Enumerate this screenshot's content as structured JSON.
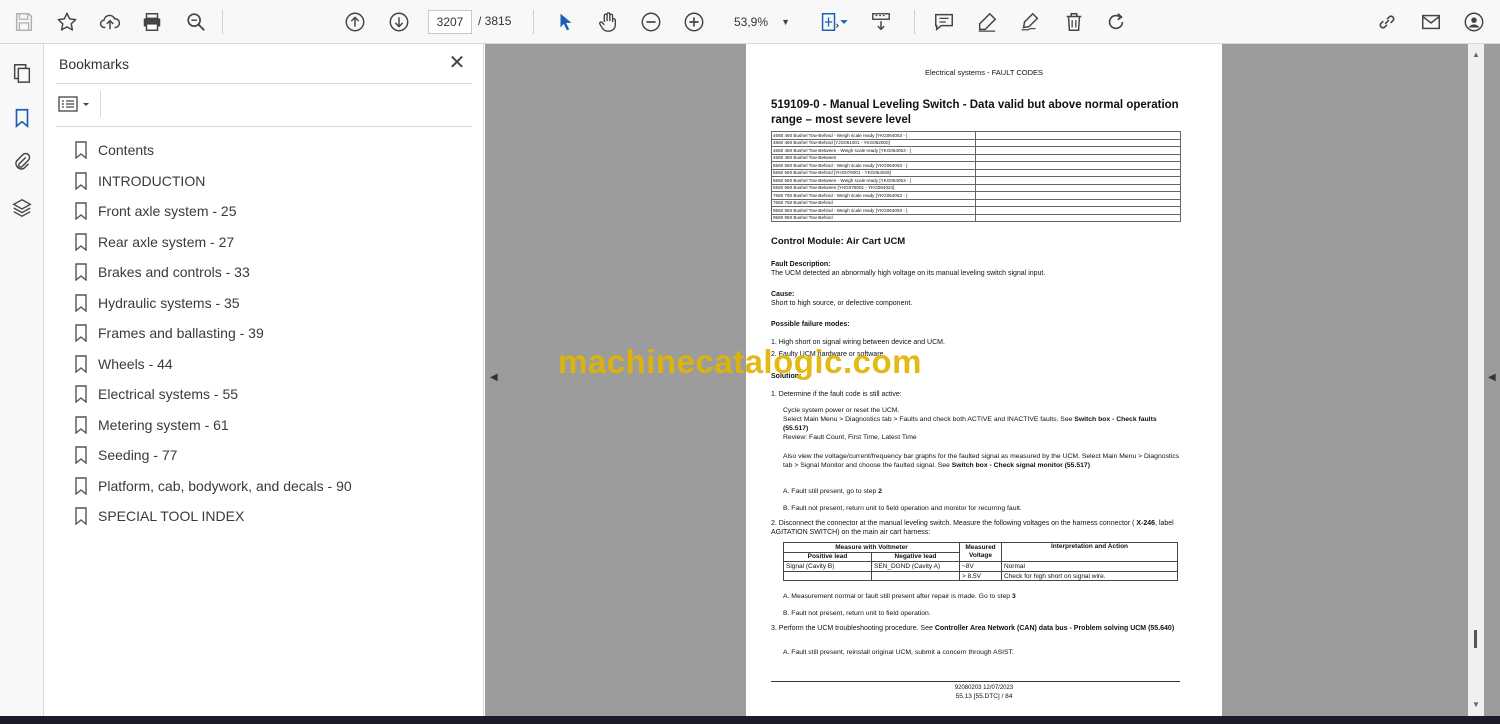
{
  "toolbar": {
    "current_page": "3207",
    "total_pages": "/ 3815",
    "zoom": "53,9%"
  },
  "bookmarks": {
    "title": "Bookmarks",
    "items": [
      {
        "label": "Contents"
      },
      {
        "label": "INTRODUCTION"
      },
      {
        "label": "Front axle system - 25"
      },
      {
        "label": "Rear axle system - 27"
      },
      {
        "label": "Brakes and controls - 33"
      },
      {
        "label": "Hydraulic systems - 35"
      },
      {
        "label": "Frames and ballasting - 39"
      },
      {
        "label": "Wheels - 44"
      },
      {
        "label": "Electrical systems - 55"
      },
      {
        "label": "Metering system - 61"
      },
      {
        "label": "Seeding - 77"
      },
      {
        "label": "Platform, cab, bodywork, and decals - 90"
      },
      {
        "label": "SPECIAL TOOL INDEX"
      }
    ]
  },
  "document": {
    "header": "Electrical systems - FAULT CODES",
    "title": "519109-0 - Manual Leveling Switch - Data valid but above normal operation range – most severe level",
    "variants": [
      "4660 460 Bushel Tow-Behind - Weigh scale ready [YKG064053 - ]",
      "4660 460 Bushel Tow-Behind [YJG051001 - YKG062000]",
      "4660 460 Bushel Tow-Between - Weigh scale ready [YKG064053 - ]",
      "4660 460 Bushel Tow-Between",
      "5560 560 Bushel Tow-Behind - Weigh scale ready [YKG064053 - ]",
      "5560 560 Bushel Tow-Behind [YHG076001 - YKG064029]",
      "5560 560 Bushel Tow-Between - Weigh scale ready [YKG064053 - ]",
      "5560 560 Bushel Tow-Between [YHG076001 - YKG064024]",
      "7660 760 Bushel Tow-Behind - Weigh scale ready [YKG064053 - ]",
      "7660 760 Bushel Tow-Behind",
      "9560 950 Bushel Tow-Behind - Weigh scale ready [YKG064053 - ]",
      "9560 950 Bushel Tow-Behind"
    ],
    "module": "Control Module:  Air Cart UCM",
    "fault_desc_label": "Fault Description:",
    "fault_desc": "The UCM detected an abnormally high voltage on its manual leveling switch signal input.",
    "cause_label": "Cause:",
    "cause": "Short to high source, or defective component.",
    "failure_label": "Possible failure modes:",
    "failure_1": "1.  High short on signal wiring between device and UCM.",
    "failure_2": "2.  Faulty UCM hardware or software.",
    "solution_label": "Solution:",
    "step1": "1.  Determine if the fault code is still active:",
    "step1_a": "Cycle system power or reset the UCM.",
    "step1_b_pre": "Select Main Menu > Diagnostics tab > Faults and check both ACTIVE and INACTIVE faults.  See ",
    "step1_b_bold": "Switch box - Check faults (55.517)",
    "step1_c": "Review:  Fault Count, First Time, Latest Time",
    "step1_d_pre": "Also view the voltage/current/frequency bar graphs for the faulted signal as measured by the UCM. Select Main Menu > Diagnostics tab > Signal Monitor and choose the faulted signal. See ",
    "step1_d_bold": "Switch box - Check signal monitor (55.517)",
    "step1_A_pre": "A.  Fault still present, go to step ",
    "step1_A_bold": "2",
    "step1_B": "B.  Fault not present, return unit to field operation and monitor for recurring fault.",
    "step2_pre": "2.  Disconnect the connector at the manual leveling switch. Measure the following voltages on the harness connector ( ",
    "step2_bold": "X-246",
    "step2_post": ", label AGITATION SWITCH) on the main air cart harness:",
    "mtable": {
      "h_measure": "Measure with Voltmeter",
      "h_measured": "Measured",
      "h_voltage": "Voltage",
      "h_interp": "Interpretation and Action",
      "h_pos": "Positive lead",
      "h_neg": "Negative lead",
      "r1_pos": "Signal (Cavity B)",
      "r1_neg": "SEN_DGND (Cavity A)",
      "r1_v": "~8V",
      "r1_i": "Normal",
      "r2_v": "> 8.5V",
      "r2_i": "Check for high short on signal wire."
    },
    "step2_A_pre": "A.  Measurement normal or fault still present after repair is made.  Go to step ",
    "step2_A_bold": "3",
    "step2_B": "B.  Fault not present, return unit to field operation.",
    "step3_pre": "3.  Perform the UCM troubleshooting procedure.  See ",
    "step3_bold": "Controller Area Network (CAN) data bus - Problem solving UCM (55.640)",
    "step3_A": "A.  Fault still present, reinstall original UCM, submit a concern through ASIST.",
    "footer_doc": "92080203 12/07/2023",
    "footer_page": "55.13 [55.DTC] / 84"
  },
  "watermark": "machinecatalogic.com",
  "colors": {
    "watermark": "#e2b400",
    "accent": "#1a5fb4",
    "viewer_bg": "#9c9c9c"
  }
}
